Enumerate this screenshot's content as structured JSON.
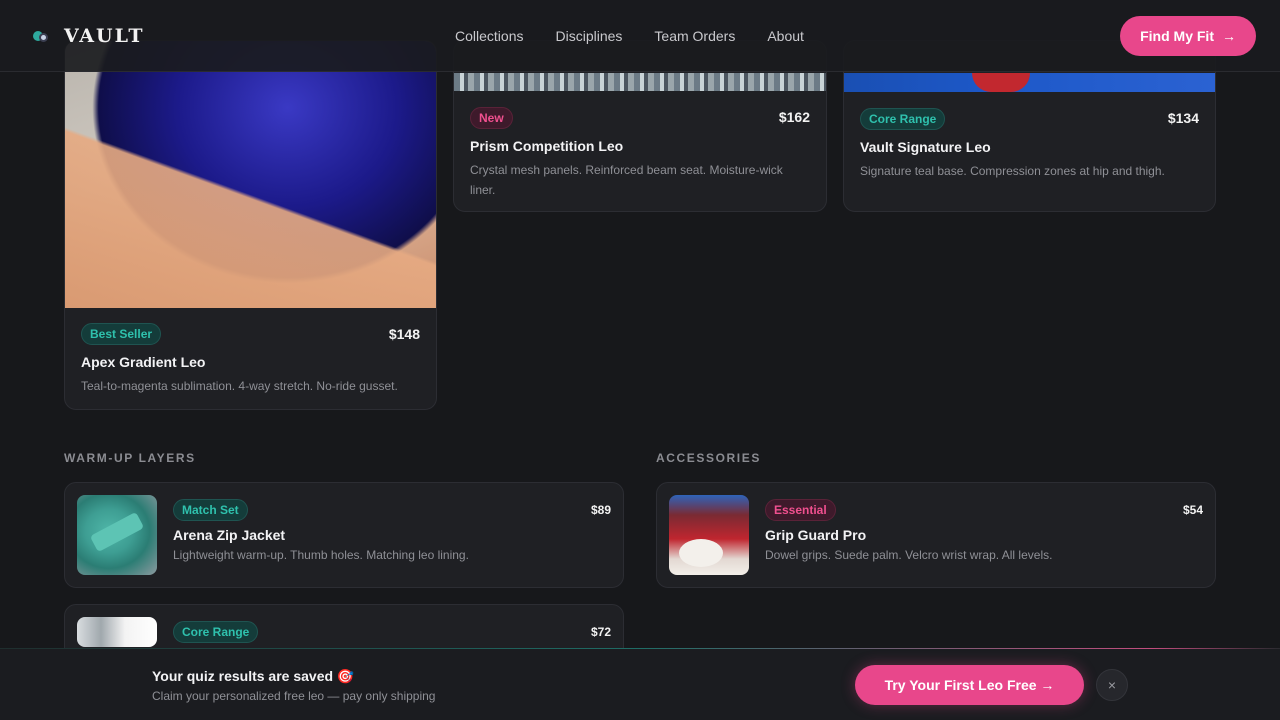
{
  "brand": {
    "name": "VAULT",
    "logo_icon": "vault-logo-icon"
  },
  "nav": {
    "links": [
      "Collections",
      "Disciplines",
      "Team Orders",
      "About"
    ],
    "cta_label": "Find My Fit",
    "cta_icon": "arrow-right-icon",
    "accent": "#e8478b"
  },
  "featured": [
    {
      "badge": "Best Seller",
      "badge_style": "teal",
      "price": "$148",
      "title": "Apex Gradient Leo",
      "desc": "Teal-to-magenta sublimation. 4-way stretch. No-ride gusset."
    },
    {
      "badge": "New",
      "badge_style": "pink",
      "price": "$162",
      "title": "Prism Competition Leo",
      "desc": "Crystal mesh panels. Reinforced beam seat. Moisture-wick liner."
    },
    {
      "badge": "Core Range",
      "badge_style": "teal",
      "price": "$134",
      "title": "Vault Signature Leo",
      "desc": "Signature teal base. Compression zones at hip and thigh."
    }
  ],
  "warmup": {
    "label": "WARM-UP LAYERS",
    "items": [
      {
        "badge": "Match Set",
        "price": "$89",
        "title": "Arena Zip Jacket",
        "desc": "Lightweight warm-up. Thumb holes. Matching leo lining."
      },
      {
        "badge": "Core Range",
        "price": "$72"
      }
    ]
  },
  "accessories": {
    "label": "ACCESSORIES",
    "items": [
      {
        "badge": "Essential",
        "price": "$54",
        "title": "Grip Guard Pro",
        "desc": "Dowel grips. Suede palm. Velcro wrist wrap. All levels."
      }
    ]
  },
  "banner": {
    "title": "Your quiz results are saved 🎯",
    "subtitle": "Claim your personalized free leo — pay only shipping",
    "cta_label": "Try Your First Leo Free →",
    "close_icon": "close-icon",
    "close_glyph": "×"
  }
}
